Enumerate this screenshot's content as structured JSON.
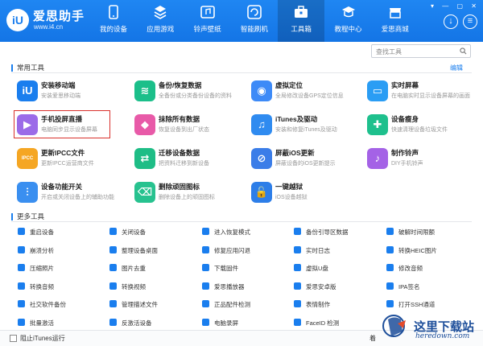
{
  "brand": {
    "name": "爱思助手",
    "url": "www.i4.cn",
    "logo_text": "iU"
  },
  "nav": [
    {
      "label": "我的设备",
      "icon": "phone-icon"
    },
    {
      "label": "应用游戏",
      "icon": "apps-icon"
    },
    {
      "label": "铃声壁纸",
      "icon": "music-icon"
    },
    {
      "label": "智能刷机",
      "icon": "refresh-icon"
    },
    {
      "label": "工具箱",
      "icon": "toolbox-icon",
      "active": true
    },
    {
      "label": "教程中心",
      "icon": "graduation-cap-icon"
    },
    {
      "label": "爱思商城",
      "icon": "shop-icon"
    }
  ],
  "window_controls": "▾ — ▢ ✕",
  "search": {
    "placeholder": "查找工具"
  },
  "common_tools": {
    "title": "常用工具",
    "edit_label": "编辑",
    "items": [
      {
        "name": "安装移动端",
        "desc": "安装爱思移动端",
        "icon": "i4-mobile-icon",
        "color": "#1a7eee"
      },
      {
        "name": "备份/恢复数据",
        "desc": "全备份或分类备份设备的资料",
        "icon": "layers-icon",
        "color": "#1bbf8a"
      },
      {
        "name": "虚拟定位",
        "desc": "全局修改设备GPS定位信息",
        "icon": "location-pin-icon",
        "color": "#3d8af7"
      },
      {
        "name": "实时屏幕",
        "desc": "在电脑实时显示设备屏幕的画面",
        "icon": "monitor-icon",
        "color": "#2a9df4"
      },
      {
        "name": "手机投屏直播",
        "desc": "电脑同步显示设备屏幕",
        "icon": "cast-icon",
        "color": "#9b6be8"
      },
      {
        "name": "抹除所有数据",
        "desc": "恢复设备到出厂状态",
        "icon": "eraser-icon",
        "color": "#e85aa8"
      },
      {
        "name": "iTunes及驱动",
        "desc": "安装和修复iTunes及驱动",
        "icon": "itunes-icon",
        "color": "#2f8bf0"
      },
      {
        "name": "设备瘦身",
        "desc": "快速清理设备垃圾文件",
        "icon": "broom-icon",
        "color": "#1ec08d"
      },
      {
        "name": "更新IPCC文件",
        "desc": "更新IPCC运营商文件",
        "icon": "sim-card-icon",
        "color": "#f5a623"
      },
      {
        "name": "迁移设备数据",
        "desc": "把资料迁移到新设备",
        "icon": "migrate-icon",
        "color": "#1ebd86"
      },
      {
        "name": "屏蔽iOS更新",
        "desc": "屏蔽设备的iOS更新提示",
        "icon": "tablet-block-icon",
        "color": "#3b7de8"
      },
      {
        "name": "制作铃声",
        "desc": "DIY手机铃声",
        "icon": "bell-music-icon",
        "color": "#a462e6"
      },
      {
        "name": "设备功能开关",
        "desc": "开启或关闭设备上的辅助功能",
        "icon": "sliders-icon",
        "color": "#3a8ff0"
      },
      {
        "name": "删除顽固图标",
        "desc": "删除设备上的顽固图标",
        "icon": "trash-icon",
        "color": "#27c28f"
      },
      {
        "name": "一键越狱",
        "desc": "iOS设备越狱",
        "icon": "unlock-icon",
        "color": "#2d7ee8"
      }
    ]
  },
  "more_tools": {
    "title": "更多工具",
    "items": [
      {
        "name": "重启设备",
        "icon": "restart-icon",
        "color": "#1a7eee"
      },
      {
        "name": "关闭设备",
        "icon": "power-icon",
        "color": "#1a7eee"
      },
      {
        "name": "进入恢复模式",
        "icon": "recovery-icon",
        "color": "#1a7eee"
      },
      {
        "name": "备份引导区数据",
        "icon": "backup-icon",
        "color": "#1a7eee"
      },
      {
        "name": "破解时间限额",
        "icon": "timer-icon",
        "color": "#1a7eee"
      },
      {
        "name": "崩溃分析",
        "icon": "crash-icon",
        "color": "#1a7eee"
      },
      {
        "name": "整理设备桌面",
        "icon": "grid-icon",
        "color": "#1a7eee"
      },
      {
        "name": "修复应用闪退",
        "icon": "wrench-icon",
        "color": "#1a7eee"
      },
      {
        "name": "实时日志",
        "icon": "log-icon",
        "color": "#1a7eee"
      },
      {
        "name": "转换HEIC图片",
        "icon": "image-convert-icon",
        "color": "#1a7eee"
      },
      {
        "name": "压缩照片",
        "icon": "compress-icon",
        "color": "#1a7eee"
      },
      {
        "name": "图片去重",
        "icon": "image-dup-icon",
        "color": "#1a7eee"
      },
      {
        "name": "下载固件",
        "icon": "download-icon",
        "color": "#1a7eee"
      },
      {
        "name": "虚拟U盘",
        "icon": "usb-icon",
        "color": "#1a7eee"
      },
      {
        "name": "修改音频",
        "icon": "audio-edit-icon",
        "color": "#1a7eee"
      },
      {
        "name": "转换音频",
        "icon": "audio-convert-icon",
        "color": "#1a7eee"
      },
      {
        "name": "转换视频",
        "icon": "video-convert-icon",
        "color": "#1a7eee"
      },
      {
        "name": "爱思播放器",
        "icon": "player-icon",
        "color": "#1a7eee"
      },
      {
        "name": "爱思安卓版",
        "icon": "android-icon",
        "color": "#1a7eee"
      },
      {
        "name": "IPA签名",
        "icon": "ipa-icon",
        "color": "#1a7eee"
      },
      {
        "name": "社交软件备份",
        "icon": "chat-backup-icon",
        "color": "#1a7eee"
      },
      {
        "name": "管理描述文件",
        "icon": "profile-icon",
        "color": "#1a7eee"
      },
      {
        "name": "正品配件检测",
        "icon": "accessory-check-icon",
        "color": "#1a7eee"
      },
      {
        "name": "表情制作",
        "icon": "emoji-icon",
        "color": "#1a7eee"
      },
      {
        "name": "打开SSH通道",
        "icon": "terminal-icon",
        "color": "#1a7eee"
      },
      {
        "name": "批量激活",
        "icon": "batch-icon",
        "color": "#1a7eee"
      },
      {
        "name": "反激活设备",
        "icon": "deactivate-icon",
        "color": "#1a7eee"
      },
      {
        "name": "电脑录屏",
        "icon": "record-icon",
        "color": "#1a7eee"
      },
      {
        "name": "FaceID 检测",
        "icon": "faceid-icon",
        "color": "#1a7eee"
      }
    ]
  },
  "bottom": {
    "checkbox_label": "阻止iTunes运行",
    "version_text": "着"
  },
  "watermark": {
    "title": "这里下载站",
    "url": "heredown.com"
  },
  "accent_color": "#1a7eee",
  "highlight_color": "#d9302c"
}
